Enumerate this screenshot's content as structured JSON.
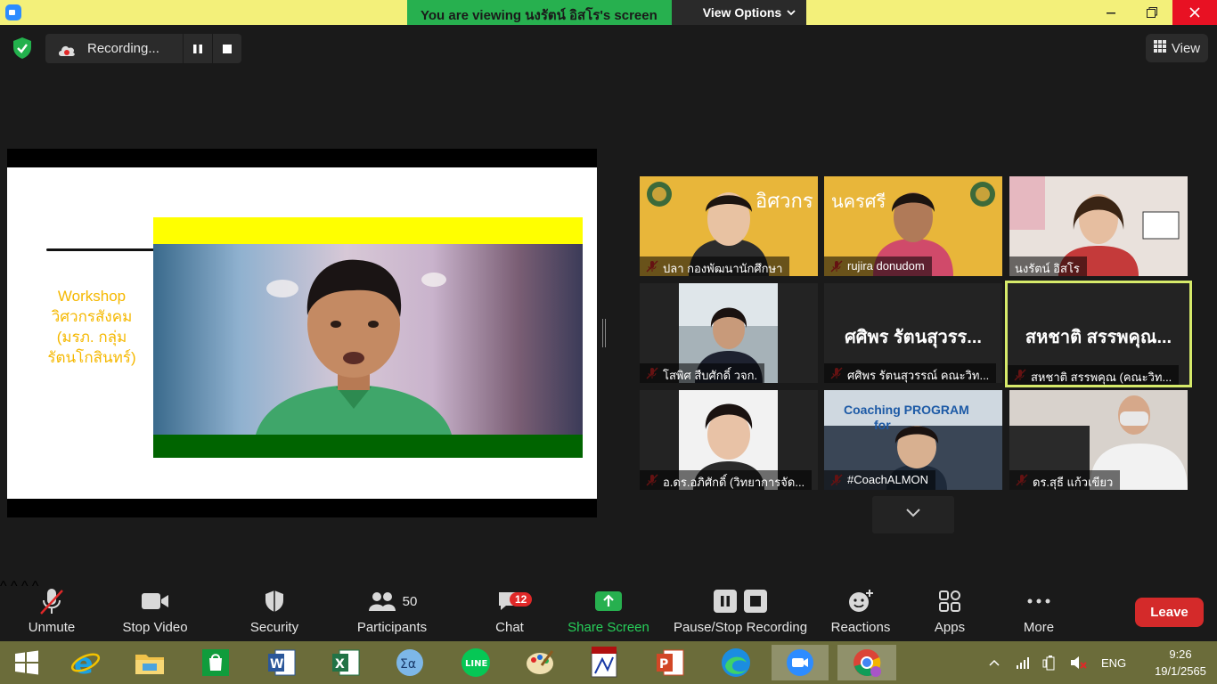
{
  "titlebar": {
    "viewing_text": "You  are  viewing นงรัตน์ อิสโร's screen",
    "view_options": "View Options",
    "chevron": "⌄"
  },
  "recording": {
    "label": "Recording..."
  },
  "view_button": {
    "label": "View"
  },
  "shared_slide": {
    "caption_line1": "Workshop",
    "caption_line2": "วิศวกรสังคม",
    "caption_line3": "(มรภ. กลุ่ม",
    "caption_line4": "รัตนโกสินทร์)"
  },
  "gallery": {
    "tiles": [
      {
        "name": "ปลา กองพัฒนานักศึกษา",
        "muted": true
      },
      {
        "name": "rujira donudom",
        "muted": true
      },
      {
        "name": "นงรัตน์ อิสโร",
        "muted": false
      },
      {
        "name": "โสพิศ สืบศักดิ์ วจก.",
        "muted": true
      },
      {
        "name": "ศศิพร รัตนสุวรรณ์ คณะวิท...",
        "big": "ศศิพร รัตนสุวรร...",
        "muted": true
      },
      {
        "name": "สหชาติ สรรพคุณ (คณะวิท...",
        "big": "สหชาติ สรรพคุณ...",
        "muted": true,
        "active": true
      },
      {
        "name": "อ.ดร.อภิศักดิ์ (วิทยาการจัด...",
        "muted": true
      },
      {
        "name": "#CoachALMON",
        "muted": true
      },
      {
        "name": "ดร.สุธี  แก้วเขียว",
        "muted": true
      }
    ],
    "coaching_text": "Coaching PROGRAM",
    "coaching_sub": "for"
  },
  "toolbar": {
    "unmute": "Unmute",
    "stop_video": "Stop Video",
    "security": "Security",
    "participants": "Participants",
    "participants_count": "50",
    "chat": "Chat",
    "chat_badge": "12",
    "share_screen": "Share Screen",
    "pause_stop_recording": "Pause/Stop Recording",
    "reactions": "Reactions",
    "apps": "Apps",
    "more": "More",
    "leave": "Leave"
  },
  "taskbar": {
    "language": "ENG",
    "time": "9:26",
    "date": "19/1/2565"
  },
  "colors": {
    "accent_green": "#27b04f",
    "leave_red": "#d42a2a",
    "title_yellow": "#f3f07a",
    "active_tile_border": "#d6ea6a"
  }
}
